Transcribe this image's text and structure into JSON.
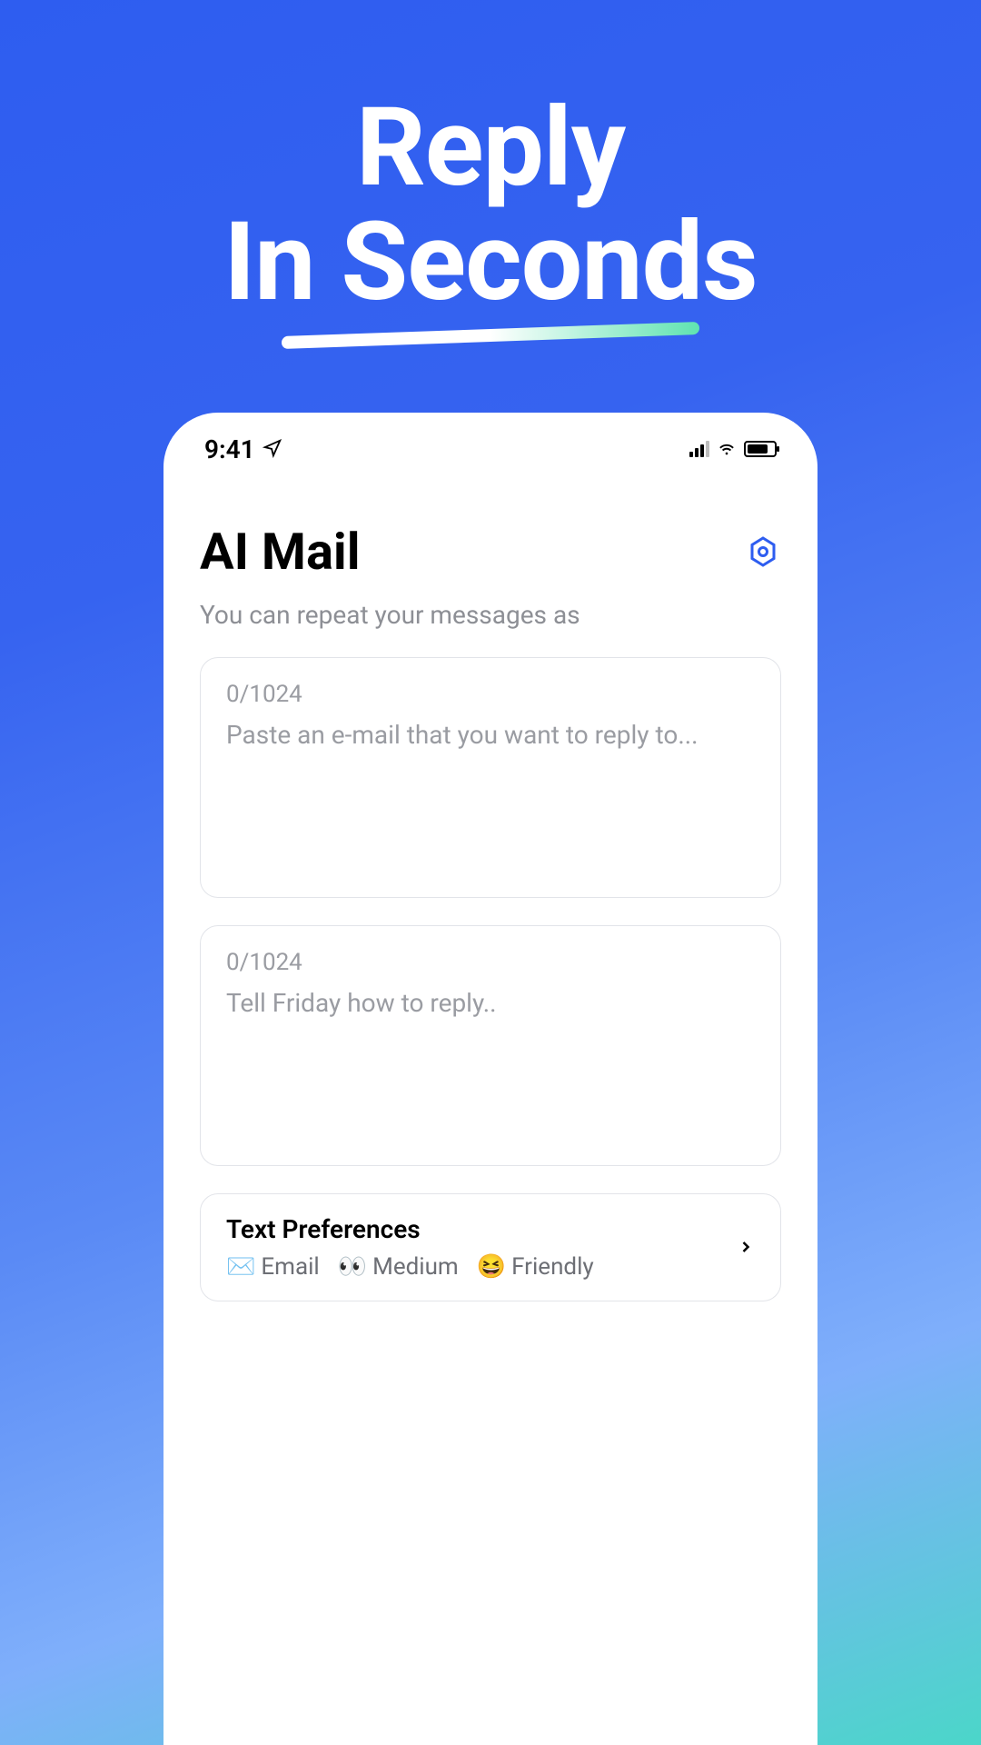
{
  "hero": {
    "line1": "Reply",
    "line2": "In Seconds"
  },
  "status": {
    "time": "9:41"
  },
  "app": {
    "title": "AI Mail",
    "subtitle": "You can repeat your messages as"
  },
  "input1": {
    "counter": "0/1024",
    "placeholder": "Paste an e-mail that you want to reply to..."
  },
  "input2": {
    "counter": "0/1024",
    "placeholder": "Tell Friday how to reply.."
  },
  "prefs": {
    "title": "Text Preferences",
    "chips": {
      "email": {
        "icon": "✉️",
        "label": "Email"
      },
      "length": {
        "icon": "👀",
        "label": "Medium"
      },
      "tone": {
        "icon": "😆",
        "label": "Friendly"
      }
    }
  }
}
